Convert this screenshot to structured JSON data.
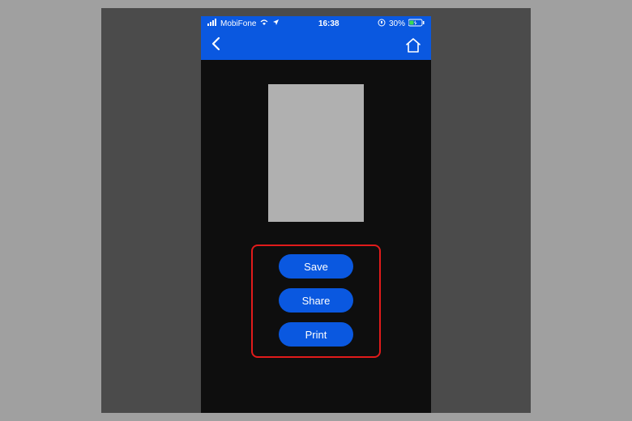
{
  "status": {
    "carrier": "MobiFone",
    "time": "16:38",
    "battery": "30%"
  },
  "actions": {
    "save": "Save",
    "share": "Share",
    "print": "Print"
  }
}
